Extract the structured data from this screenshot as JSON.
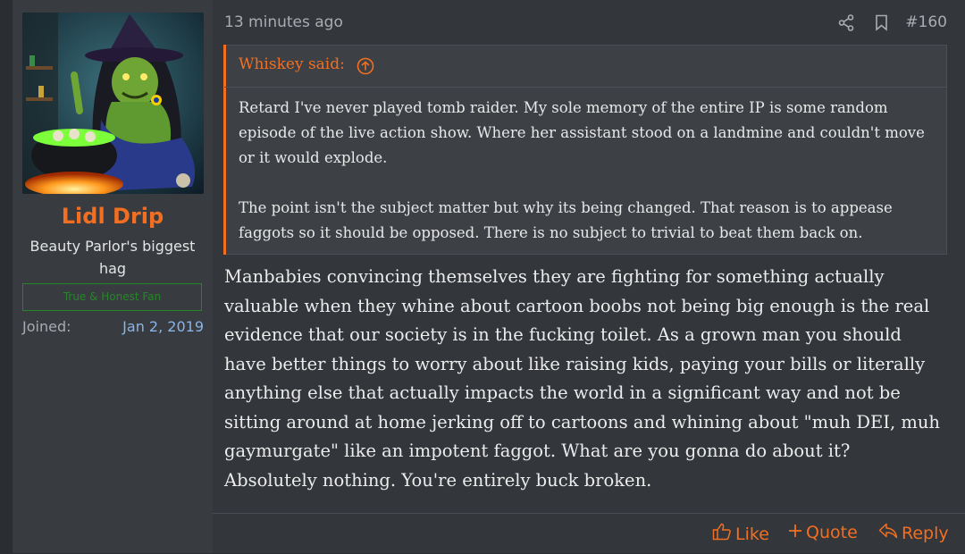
{
  "user": {
    "username": "Lidl Drip",
    "title": "Beauty Parlor's biggest hag",
    "banner": "True & Honest Fan",
    "joined_label": "Joined:",
    "joined_value": "Jan 2, 2019",
    "avatar_icon": "witch-avatar"
  },
  "post": {
    "timestamp": "13 minutes ago",
    "number": "#160",
    "quote": {
      "author": "Whiskey said:",
      "paragraphs": [
        "Retard I've never played tomb raider. My sole memory of the entire IP is some random episode of the live action show. Where her assistant stood on a landmine and couldn't move or it would explode.",
        "The point isn't the subject matter but why its being changed. That reason is to appease faggots so it should be opposed. There is no subject to trivial to beat them back on."
      ]
    },
    "message": "Manbabies convincing themselves they are fighting for something actually valuable when they whine about cartoon boobs not being big enough is the real evidence that our society is in the fucking toilet. As a grown man you should have better things to worry about like raising kids, paying your bills or literally anything else that actually impacts the world in a significant way and not be sitting around at home jerking off to cartoons and whining about \"muh DEI, muh gaymurgate\" like an impotent faggot. What are you gonna do about it? Absolutely nothing. You're entirely buck broken."
  },
  "actions": {
    "like": "Like",
    "quote": "Quote",
    "reply": "Reply"
  },
  "colors": {
    "accent": "#f26f21",
    "link": "#8ab4e6",
    "banner": "#1f9a1f"
  }
}
